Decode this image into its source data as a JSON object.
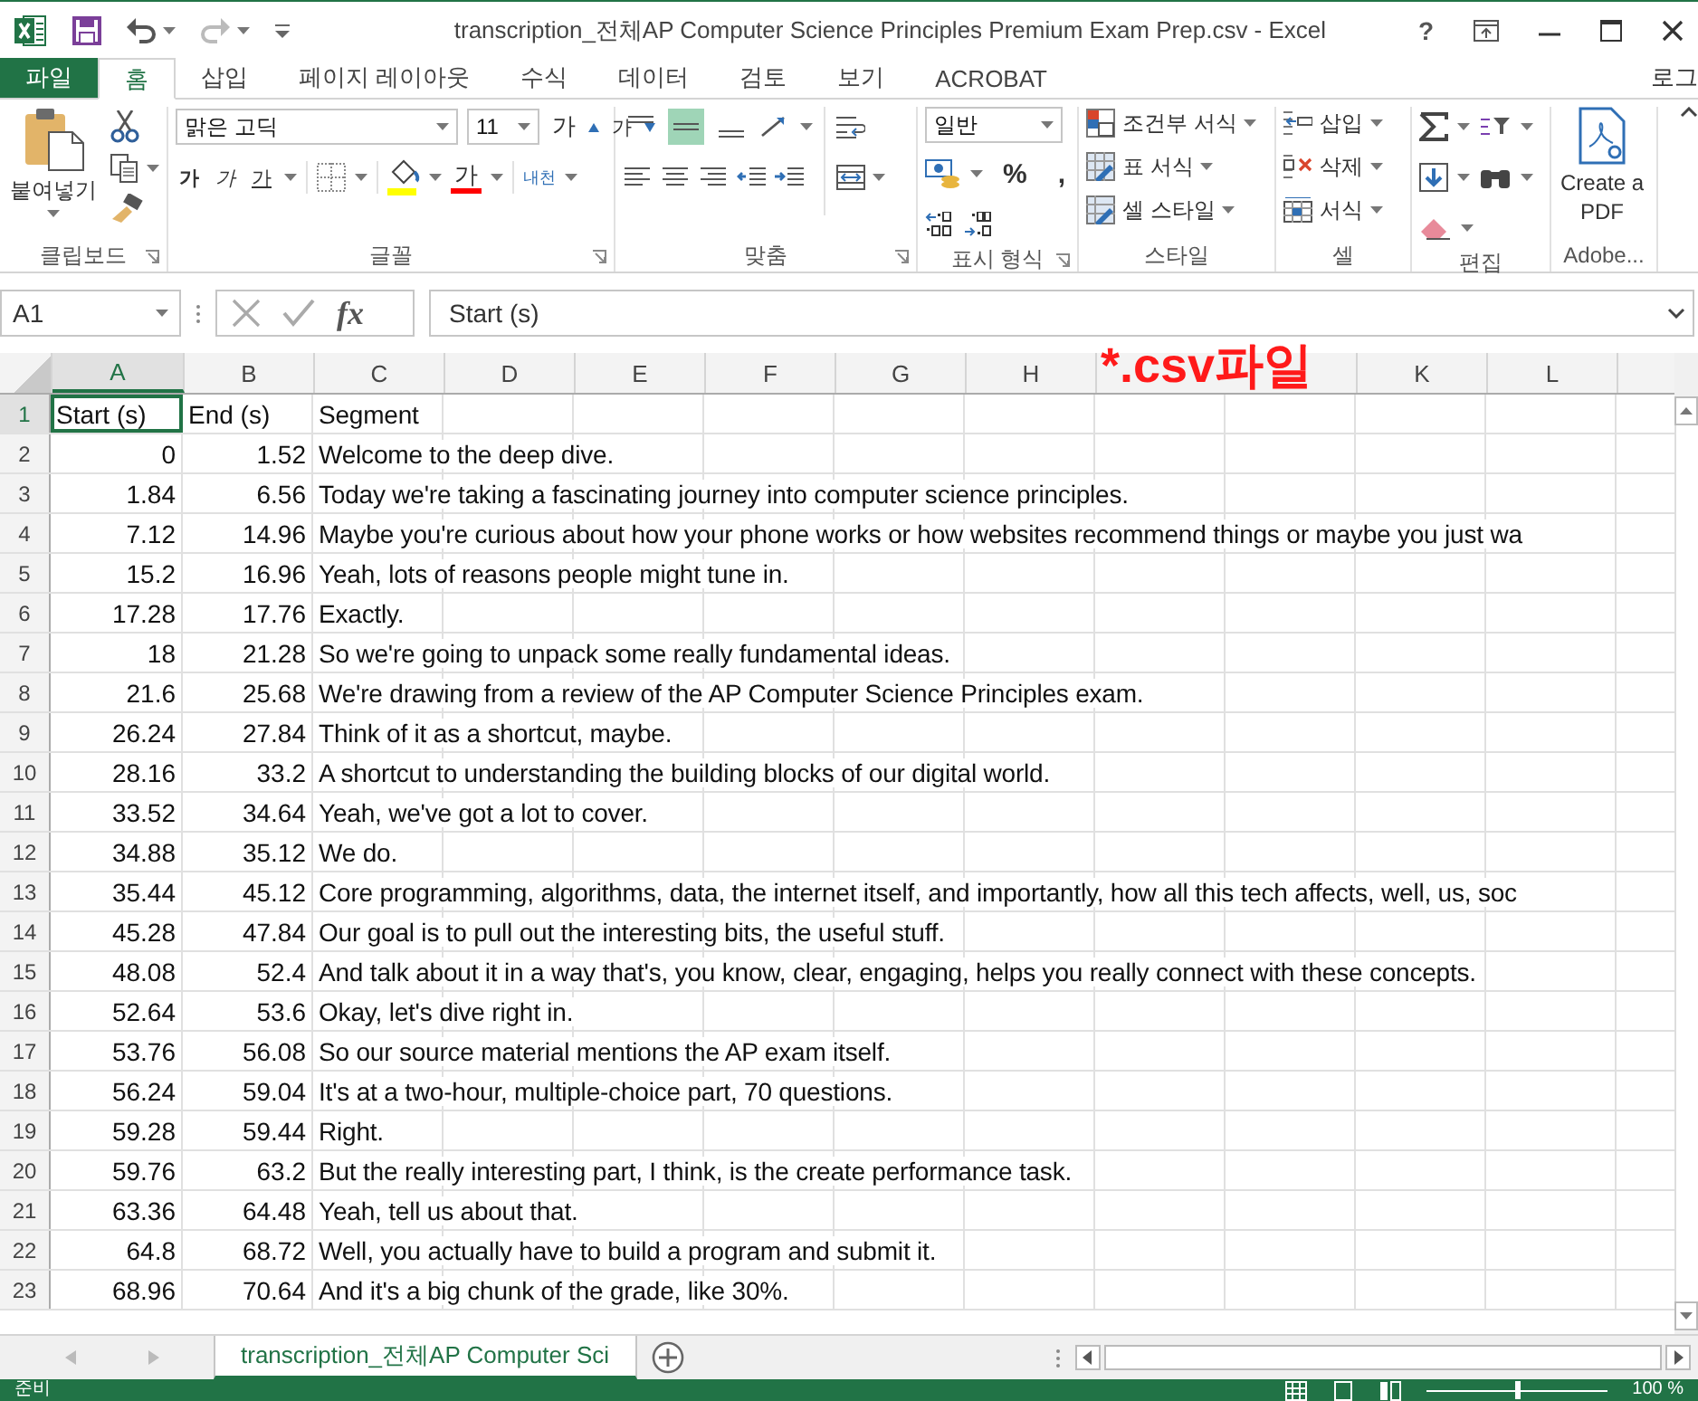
{
  "window": {
    "title": "transcription_전체AP Computer Science Principles Premium Exam Prep.csv - Excel",
    "help": "?"
  },
  "tabs": [
    {
      "label": "파일",
      "kind": "file",
      "selected": false
    },
    {
      "label": "홈",
      "kind": "tab",
      "selected": true
    },
    {
      "label": "삽입",
      "kind": "tab",
      "selected": false
    },
    {
      "label": "페이지 레이아웃",
      "kind": "tab",
      "selected": false
    },
    {
      "label": "수식",
      "kind": "tab",
      "selected": false
    },
    {
      "label": "데이터",
      "kind": "tab",
      "selected": false
    },
    {
      "label": "검토",
      "kind": "tab",
      "selected": false
    },
    {
      "label": "보기",
      "kind": "tab",
      "selected": false
    },
    {
      "label": "ACROBAT",
      "kind": "tab",
      "selected": false
    }
  ],
  "account": "로그",
  "ribbon": {
    "clipboard": {
      "name": "클립보드",
      "paste": "붙여넣기"
    },
    "font": {
      "name": "글꼴",
      "font_name": "맑은 고딕",
      "font_size": "11",
      "grow": "가",
      "shrink": "가",
      "bold": "가",
      "italic": "가",
      "underline": "가",
      "font_color": "가",
      "phonetic": "내천"
    },
    "alignment": {
      "name": "맞춤",
      "vertical_align": [
        {
          "selected": false
        },
        {
          "selected": true
        },
        {
          "selected": false
        }
      ]
    },
    "number": {
      "name": "표시 형식",
      "format": "일반",
      "percent": "%",
      "comma": ","
    },
    "styles": {
      "name": "스타일",
      "items": [
        "조건부 서식",
        "표 서식",
        "셀 스타일"
      ]
    },
    "cells": {
      "name": "셀",
      "items": [
        "삽입",
        "삭제",
        "서식"
      ]
    },
    "editing": {
      "name": "편집"
    },
    "adobe": {
      "name": "Adobe...",
      "button": "Create a PDF"
    }
  },
  "formula_bar": {
    "name_box": "A1",
    "fx": "fx",
    "value": "Start (s)"
  },
  "sheet": {
    "column_headers": [
      {
        "label": "A",
        "selected": true
      },
      {
        "label": "B",
        "selected": false
      },
      {
        "label": "C",
        "selected": false
      },
      {
        "label": "D",
        "selected": false
      },
      {
        "label": "E",
        "selected": false
      },
      {
        "label": "F",
        "selected": false
      },
      {
        "label": "G",
        "selected": false
      },
      {
        "label": "H",
        "selected": false
      },
      {
        "kind": "annotation",
        "text": "*.csv파일"
      },
      {
        "label": "K",
        "selected": false
      },
      {
        "label": "L",
        "selected": false
      }
    ],
    "rows": [
      {
        "number": "1",
        "kind": "header",
        "selected": true,
        "cells": [
          "Start (s)",
          "End (s)",
          "Segment"
        ]
      },
      {
        "number": "2",
        "kind": "data",
        "selected": false,
        "cells": [
          "0",
          "1.52",
          "Welcome to the deep dive."
        ]
      },
      {
        "number": "3",
        "kind": "data",
        "selected": false,
        "cells": [
          "1.84",
          "6.56",
          "Today we're taking a fascinating journey into computer science principles."
        ]
      },
      {
        "number": "4",
        "kind": "data",
        "selected": false,
        "cells": [
          "7.12",
          "14.96",
          "Maybe you're curious about how your phone works or how websites recommend things or maybe you just wa"
        ]
      },
      {
        "number": "5",
        "kind": "data",
        "selected": false,
        "cells": [
          "15.2",
          "16.96",
          "Yeah, lots of reasons people might tune in."
        ]
      },
      {
        "number": "6",
        "kind": "data",
        "selected": false,
        "cells": [
          "17.28",
          "17.76",
          "Exactly."
        ]
      },
      {
        "number": "7",
        "kind": "data",
        "selected": false,
        "cells": [
          "18",
          "21.28",
          "So we're going to unpack some really fundamental ideas."
        ]
      },
      {
        "number": "8",
        "kind": "data",
        "selected": false,
        "cells": [
          "21.6",
          "25.68",
          "We're drawing from a review of the AP Computer Science Principles exam."
        ]
      },
      {
        "number": "9",
        "kind": "data",
        "selected": false,
        "cells": [
          "26.24",
          "27.84",
          "Think of it as a shortcut, maybe."
        ]
      },
      {
        "number": "10",
        "kind": "data",
        "selected": false,
        "cells": [
          "28.16",
          "33.2",
          "A shortcut to understanding the building blocks of our digital world."
        ]
      },
      {
        "number": "11",
        "kind": "data",
        "selected": false,
        "cells": [
          "33.52",
          "34.64",
          "Yeah, we've got a lot to cover."
        ]
      },
      {
        "number": "12",
        "kind": "data",
        "selected": false,
        "cells": [
          "34.88",
          "35.12",
          "We do."
        ]
      },
      {
        "number": "13",
        "kind": "data",
        "selected": false,
        "cells": [
          "35.44",
          "45.12",
          "Core programming, algorithms, data, the internet itself, and importantly, how all this tech affects, well, us, soc"
        ]
      },
      {
        "number": "14",
        "kind": "data",
        "selected": false,
        "cells": [
          "45.28",
          "47.84",
          "Our goal is to pull out the interesting bits, the useful stuff."
        ]
      },
      {
        "number": "15",
        "kind": "data",
        "selected": false,
        "cells": [
          "48.08",
          "52.4",
          "And talk about it in a way that's, you know, clear, engaging, helps you really connect with these concepts."
        ]
      },
      {
        "number": "16",
        "kind": "data",
        "selected": false,
        "cells": [
          "52.64",
          "53.6",
          "Okay, let's dive right in."
        ]
      },
      {
        "number": "17",
        "kind": "data",
        "selected": false,
        "cells": [
          "53.76",
          "56.08",
          "So our source material mentions the AP exam itself."
        ]
      },
      {
        "number": "18",
        "kind": "data",
        "selected": false,
        "cells": [
          "56.24",
          "59.04",
          "It's at a two-hour, multiple-choice part, 70 questions."
        ]
      },
      {
        "number": "19",
        "kind": "data",
        "selected": false,
        "cells": [
          "59.28",
          "59.44",
          "Right."
        ]
      },
      {
        "number": "20",
        "kind": "data",
        "selected": false,
        "cells": [
          "59.76",
          "63.2",
          "But the really interesting part, I think, is the create performance task."
        ]
      },
      {
        "number": "21",
        "kind": "data",
        "selected": false,
        "cells": [
          "63.36",
          "64.48",
          "Yeah, tell us about that."
        ]
      },
      {
        "number": "22",
        "kind": "data",
        "selected": false,
        "cells": [
          "64.8",
          "68.72",
          "Well, you actually have to build a program and submit it."
        ]
      },
      {
        "number": "23",
        "kind": "data",
        "selected": false,
        "cells": [
          "68.96",
          "70.64",
          "And it's a big chunk of the grade, like 30%."
        ]
      }
    ]
  },
  "sheet_tabs": [
    {
      "label": "transcription_전체AP Computer Sci",
      "selected": true
    }
  ],
  "status_bar": {
    "text": "준비",
    "zoom_slider": {
      "level": 0.5
    },
    "zoom": "100 %"
  }
}
